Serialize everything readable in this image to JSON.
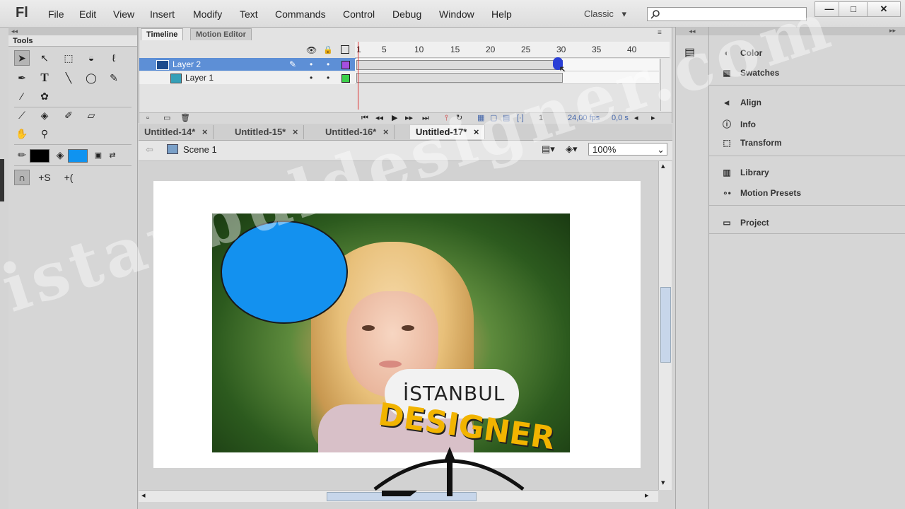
{
  "app": {
    "logo": "Fl",
    "workspace": "Classic",
    "workspace_arrow": "▾"
  },
  "menu": [
    "File",
    "Edit",
    "View",
    "Insert",
    "Modify",
    "Text",
    "Commands",
    "Control",
    "Debug",
    "Window",
    "Help"
  ],
  "window_buttons": {
    "minimize": "—",
    "restore": "□",
    "close": "✕"
  },
  "tools_panel": {
    "title": "Tools",
    "collapse": "◂◂"
  },
  "timeline": {
    "tabs": [
      "Timeline",
      "Motion Editor"
    ],
    "layers": [
      {
        "name": "Layer 2",
        "color": "#a64fe0",
        "selected": true
      },
      {
        "name": "Layer 1",
        "color": "#3cd04a",
        "selected": false
      }
    ],
    "ruler_numbers": [
      "1",
      "5",
      "10",
      "15",
      "20",
      "25",
      "30",
      "35",
      "40"
    ],
    "current_frame": "1",
    "fps": "24,00 fps",
    "time": "0,0 s"
  },
  "doc_tabs": [
    {
      "label": "Untitled-14*",
      "close": "×",
      "active": false
    },
    {
      "label": "Untitled-15*",
      "close": "×",
      "active": false
    },
    {
      "label": "Untitled-16*",
      "close": "×",
      "active": false
    },
    {
      "label": "Untitled-17*",
      "close": "×",
      "active": true
    }
  ],
  "scene": {
    "label": "Scene 1",
    "zoom": "100%"
  },
  "stage": {
    "circle_color": "#0f93f0",
    "stroke_color": "#1a1a1a",
    "fill_color": "#1391ef"
  },
  "right_panel": {
    "group1": [
      "Color",
      "Swatches"
    ],
    "group2": [
      "Align",
      "Info",
      "Transform"
    ],
    "group3": [
      "Library",
      "Motion Presets"
    ],
    "group4": [
      "Project"
    ]
  },
  "watermark": {
    "text": "istanbuldesigner.com"
  },
  "logo_overlay": {
    "line1": "İSTANBUL",
    "line2": "DESIGNER"
  }
}
